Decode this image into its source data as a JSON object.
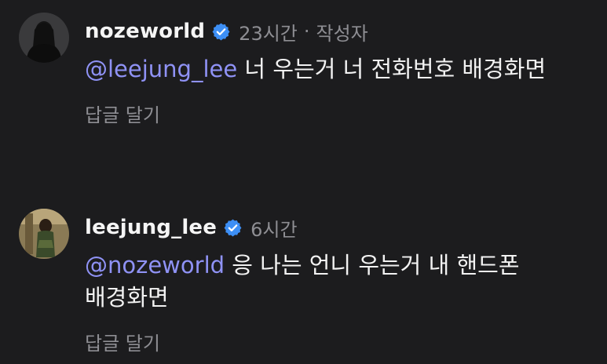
{
  "comments": [
    {
      "username": "nozeworld",
      "time": "23시간",
      "separator": "·",
      "author_tag": "작성자",
      "mention": "@leejung_lee",
      "text": " 너 우는거 너 전화번호 배경화면",
      "reply_label": "답글 달기",
      "avatar_icon": "profile-photo"
    },
    {
      "username": "leejung_lee",
      "time": "6시간",
      "mention": "@nozeworld",
      "text": " 응 나는 언니 우는거 내 핸드폰 배경화면",
      "reply_label": "답글 달기",
      "avatar_icon": "profile-photo"
    }
  ],
  "colors": {
    "background": "#1c1c1e",
    "mention": "#8f92f5",
    "verified": "#3d8ff5",
    "secondary_text": "#8e8e93"
  }
}
